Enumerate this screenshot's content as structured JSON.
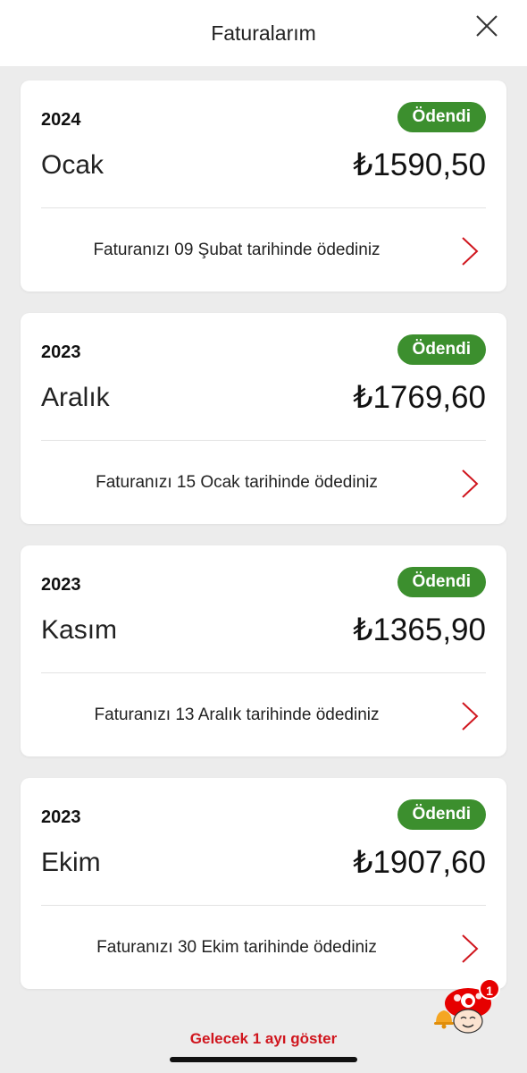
{
  "header": {
    "title": "Faturalarım",
    "close_icon": "close-icon"
  },
  "colors": {
    "badge_green": "#3c8f2e",
    "accent_red": "#d0161e",
    "background": "#ececec",
    "card": "#ffffff"
  },
  "invoices": [
    {
      "year": "2024",
      "status": "Ödendi",
      "month": "Ocak",
      "amount": "₺1590,50",
      "payment_text": "Faturanızı 09 Şubat tarihinde ödediniz"
    },
    {
      "year": "2023",
      "status": "Ödendi",
      "month": "Aralık",
      "amount": "₺1769,60",
      "payment_text": "Faturanızı 15 Ocak tarihinde ödediniz"
    },
    {
      "year": "2023",
      "status": "Ödendi",
      "month": "Kasım",
      "amount": "₺1365,90",
      "payment_text": "Faturanızı 13 Aralık tarihinde ödediniz"
    },
    {
      "year": "2023",
      "status": "Ödendi",
      "month": "Ekim",
      "amount": "₺1907,60",
      "payment_text": "Faturanızı 30 Ekim tarihinde ödediniz"
    }
  ],
  "footer": {
    "show_next_month": "Gelecek 1 ayı göster"
  },
  "assistant": {
    "icon": "assistant-mascot-icon",
    "notification_count": "1"
  }
}
